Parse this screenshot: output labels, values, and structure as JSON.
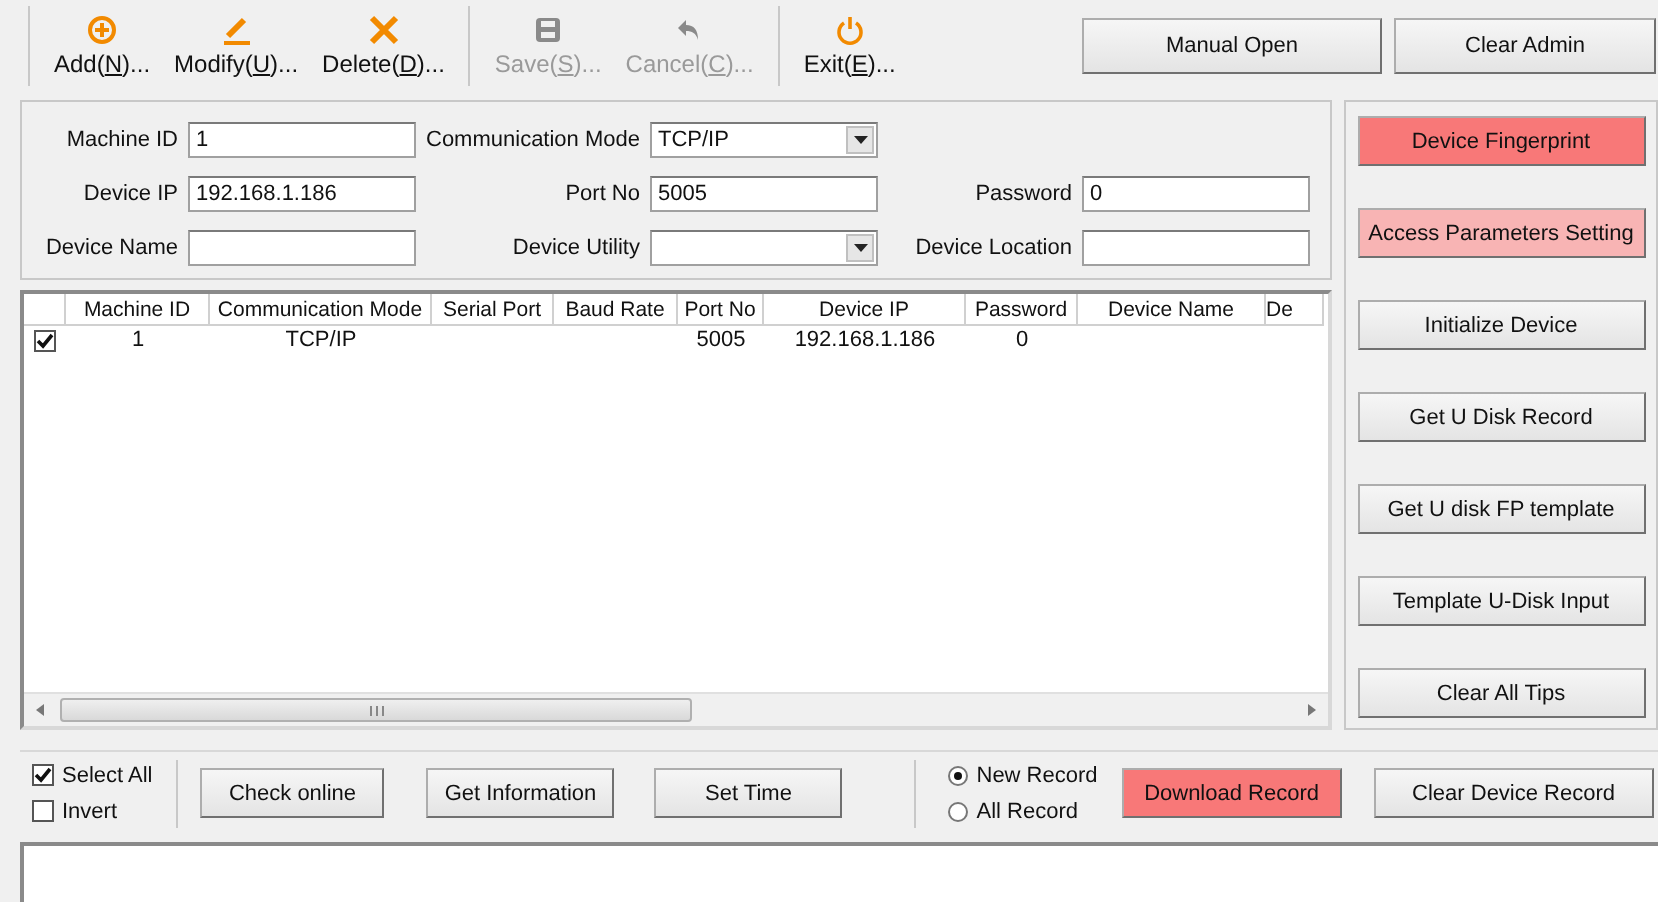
{
  "toolbar": {
    "groups": [
      [
        {
          "kind": "add",
          "label": [
            "Add(",
            "N",
            ")..."
          ],
          "disabled": false
        },
        {
          "kind": "modify",
          "label": [
            "Modify(",
            "U",
            ")..."
          ],
          "disabled": false
        },
        {
          "kind": "delete",
          "label": [
            "Delete(",
            "D",
            ")..."
          ],
          "disabled": false
        }
      ],
      [
        {
          "kind": "save",
          "label": [
            "Save(",
            "S",
            ")..."
          ],
          "disabled": true
        },
        {
          "kind": "cancel",
          "label": [
            "Cancel(",
            "C",
            ")..."
          ],
          "disabled": true
        }
      ],
      [
        {
          "kind": "exit",
          "label": [
            "Exit(",
            "E",
            ")..."
          ],
          "disabled": false
        }
      ]
    ],
    "buttons": [
      "Manual Open",
      "Clear Admin"
    ]
  },
  "form": {
    "rows": [
      [
        {
          "label": "Machine ID",
          "value": "1",
          "kind": "text"
        },
        {
          "label": "Communication Mode",
          "value": "TCP/IP",
          "kind": "select"
        }
      ],
      [
        {
          "label": "Device IP",
          "value": "192.168.1.186",
          "kind": "text"
        },
        {
          "label": "Port No",
          "value": "5005",
          "kind": "text"
        },
        {
          "label": "Password",
          "value": "0",
          "kind": "text"
        }
      ],
      [
        {
          "label": "Device Name",
          "kind": "text"
        },
        {
          "label": "Device Utility",
          "kind": "select"
        },
        {
          "label": "Device Location",
          "kind": "text"
        }
      ]
    ]
  },
  "table": {
    "columns": [
      "Machine ID",
      "Communication Mode",
      "Serial Port",
      "Baud Rate",
      "Port No",
      "Device IP",
      "Password",
      "Device Name",
      "De"
    ],
    "rows": [
      {
        "checked": true,
        "cells": [
          "1",
          "TCP/IP",
          null,
          null,
          "5005",
          "192.168.1.186",
          "0",
          null,
          null
        ]
      }
    ]
  },
  "side_buttons": [
    {
      "label": "Device Fingerprint",
      "color": "#f87878"
    },
    {
      "label": "Access Parameters Setting",
      "color": "#f8b4b4"
    },
    {
      "label": "Initialize Device"
    },
    {
      "label": "Get U Disk Record"
    },
    {
      "label": "Get U disk FP template"
    },
    {
      "label": "Template U-Disk Input"
    },
    {
      "label": "Clear All Tips"
    }
  ],
  "bottom": {
    "checks": [
      {
        "label": "Select All",
        "checked": true
      },
      {
        "label": "Invert",
        "checked": false
      }
    ],
    "buttons": [
      "Check online",
      "Get Information",
      "Set Time"
    ],
    "radios": [
      {
        "label": "New Record",
        "selected": true
      },
      {
        "label": "All Record",
        "selected": false
      }
    ],
    "actions": [
      {
        "label": "Download Record",
        "color": "#f87878"
      },
      {
        "label": "Clear Device Record"
      }
    ]
  }
}
